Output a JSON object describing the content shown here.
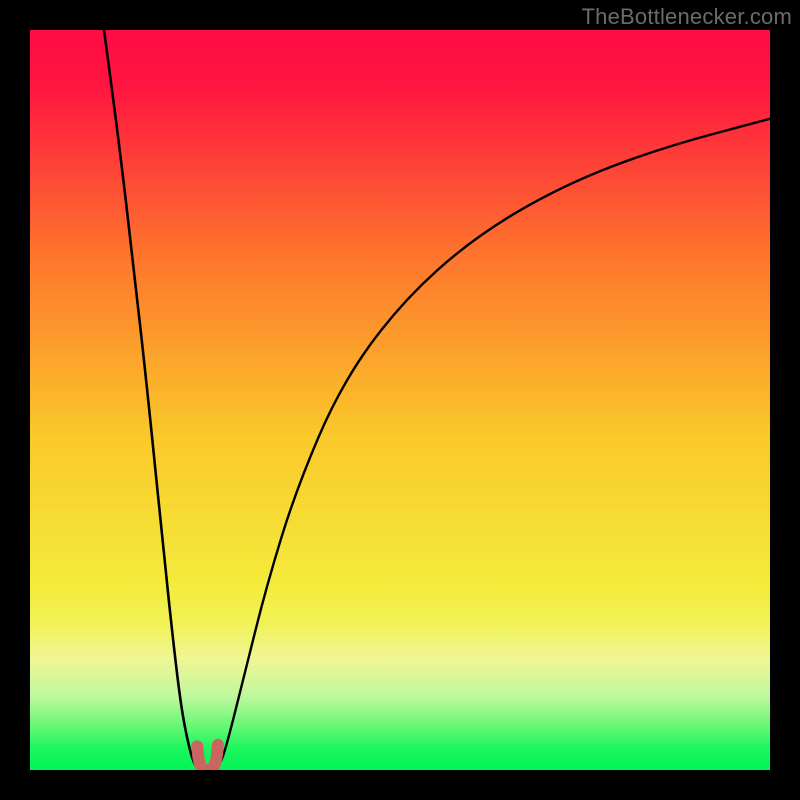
{
  "attribution": "TheBottlenecker.com",
  "chart_data": {
    "type": "line",
    "title": "",
    "xlabel": "",
    "ylabel": "",
    "xlim": [
      0,
      100
    ],
    "ylim": [
      0,
      100
    ],
    "gradient_stops": [
      {
        "pct": 0,
        "color": "#ff0b47"
      },
      {
        "pct": 8,
        "color": "#ff173f"
      },
      {
        "pct": 30,
        "color": "#fe732d"
      },
      {
        "pct": 55,
        "color": "#fac92a"
      },
      {
        "pct": 75,
        "color": "#f4eb3b"
      },
      {
        "pct": 80,
        "color": "#f1f254"
      },
      {
        "pct": 85,
        "color": "#eff695"
      },
      {
        "pct": 90,
        "color": "#c0f89d"
      },
      {
        "pct": 94,
        "color": "#68f875"
      },
      {
        "pct": 97,
        "color": "#1ef65e"
      },
      {
        "pct": 100,
        "color": "#00f556"
      }
    ],
    "series": [
      {
        "name": "left-branch",
        "color": "#000000",
        "x": [
          10,
          12,
          14,
          16,
          18,
          19.5,
          20.5,
          21.5,
          22.2,
          22.8
        ],
        "y": [
          100,
          85,
          68,
          50,
          30,
          16,
          8,
          3,
          0.8,
          0
        ]
      },
      {
        "name": "right-branch",
        "color": "#000000",
        "x": [
          25.2,
          26,
          27,
          29,
          32,
          36,
          42,
          50,
          60,
          72,
          85,
          100
        ],
        "y": [
          0,
          1.5,
          5,
          13,
          25,
          38,
          52,
          63,
          72,
          79,
          84,
          88
        ]
      },
      {
        "name": "trough-marker",
        "color": "#c9665f",
        "x": [
          22.6,
          22.8,
          23.2,
          23.8,
          24.4,
          24.8,
          25.2,
          25.4
        ],
        "y": [
          3.2,
          1.2,
          0.2,
          0,
          0,
          0.3,
          1.4,
          3.4
        ]
      }
    ]
  }
}
